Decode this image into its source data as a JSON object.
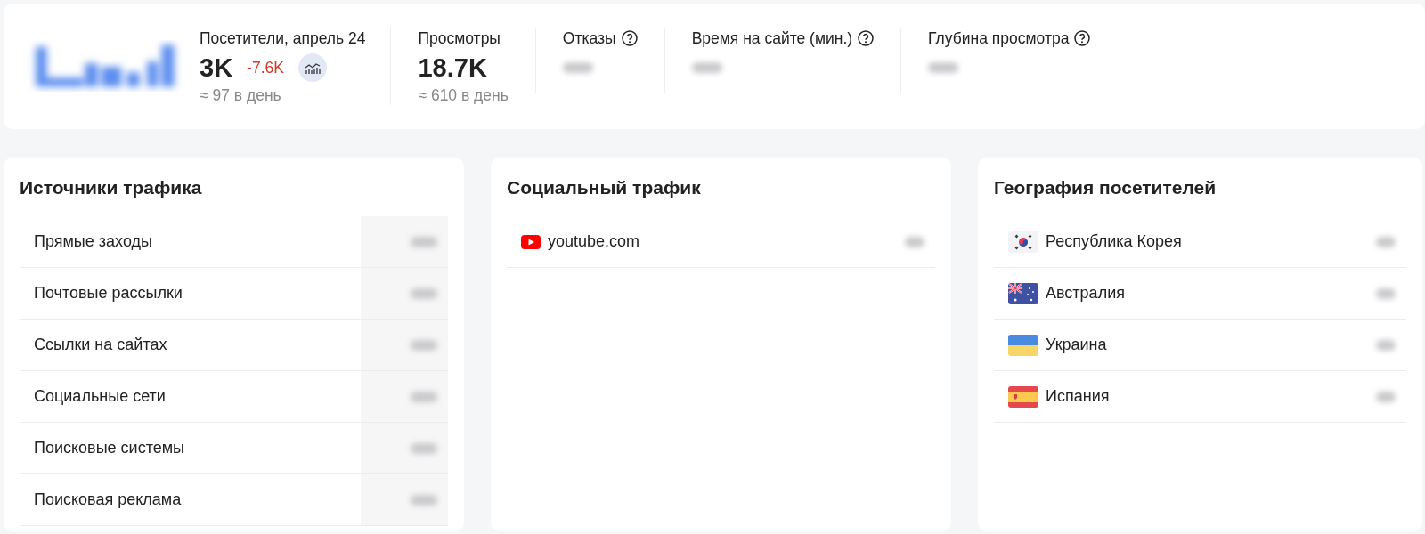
{
  "summary": {
    "stats": [
      {
        "kind": "primary",
        "label": "Посетители, апрель 24",
        "value": "3K",
        "delta": "-7.6K",
        "per_day": "≈ 97 в день"
      },
      {
        "kind": "plain",
        "label": "Просмотры",
        "value": "18.7K",
        "per_day": "≈ 610 в день"
      },
      {
        "kind": "hidden",
        "label": "Отказы"
      },
      {
        "kind": "hidden",
        "label": "Время на сайте (мин.)"
      },
      {
        "kind": "hidden",
        "label": "Глубина просмотра"
      }
    ]
  },
  "panels": [
    {
      "kind": "sources",
      "title": "Источники трафика",
      "rows": [
        {
          "label": "Прямые заходы"
        },
        {
          "label": "Почтовые рассылки"
        },
        {
          "label": "Ссылки на сайтах"
        },
        {
          "label": "Социальные сети"
        },
        {
          "label": "Поисковые системы"
        },
        {
          "label": "Поисковая реклама"
        }
      ]
    },
    {
      "kind": "social",
      "title": "Социальный трафик",
      "rows": [
        {
          "label": "youtube.com"
        }
      ]
    },
    {
      "kind": "geo",
      "title": "География посетителей",
      "rows": [
        {
          "label": "Республика Корея"
        },
        {
          "label": "Австралия"
        },
        {
          "label": "Украина"
        },
        {
          "label": "Испания"
        }
      ]
    }
  ]
}
